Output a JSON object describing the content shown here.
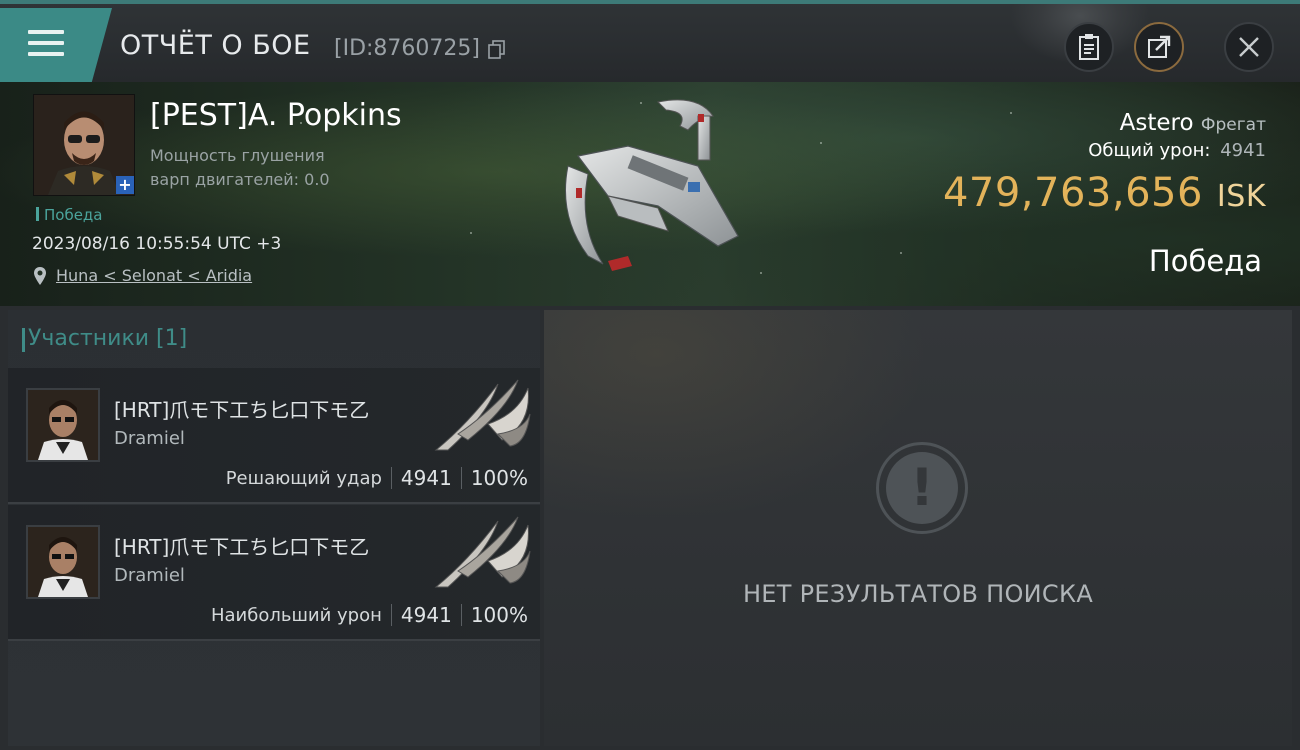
{
  "header": {
    "title": "ОТЧЁТ О БОЕ",
    "report_id": "[ID:8760725]"
  },
  "icons": {
    "menu": "menu-icon",
    "copy": "copy-icon",
    "clipboard": "clipboard-icon",
    "share": "share-icon",
    "close": "close-icon",
    "location": "location-pin-icon",
    "no_results": "exclamation-icon"
  },
  "victim": {
    "name": "[PEST]A. Popkins",
    "stat_line1": "Мощность глушения",
    "stat_line2": "варп  двигателей: 0.0",
    "status": "Победа",
    "timestamp": "2023/08/16 10:55:54 UTC +3",
    "location": "Huna < Selonat < Aridia",
    "badge": "+"
  },
  "ship": {
    "name": "Astero",
    "class": "Фрегат",
    "total_damage_label": "Общий урон:",
    "total_damage": "4941",
    "isk_value": "479,763,656",
    "isk_unit": "ISK",
    "result": "Победа"
  },
  "participants": {
    "title": "Участники [1]",
    "rows": [
      {
        "name": "[HRT]爪モ下工ち匕口下モ乙",
        "corp": "Dramiel",
        "role": "Решающий удар",
        "damage": "4941",
        "percent": "100%"
      },
      {
        "name": "[HRT]爪モ下工ち匕口下モ乙",
        "corp": "Dramiel",
        "role": "Наибольший урон",
        "damage": "4941",
        "percent": "100%"
      }
    ]
  },
  "empty_state": {
    "message": "НЕТ РЕЗУЛЬТАТОВ ПОИСКА"
  },
  "colors": {
    "accent_teal": "#3b8a86",
    "isk_gold": "#e3b35a",
    "victory_green": "#4ba49c"
  }
}
